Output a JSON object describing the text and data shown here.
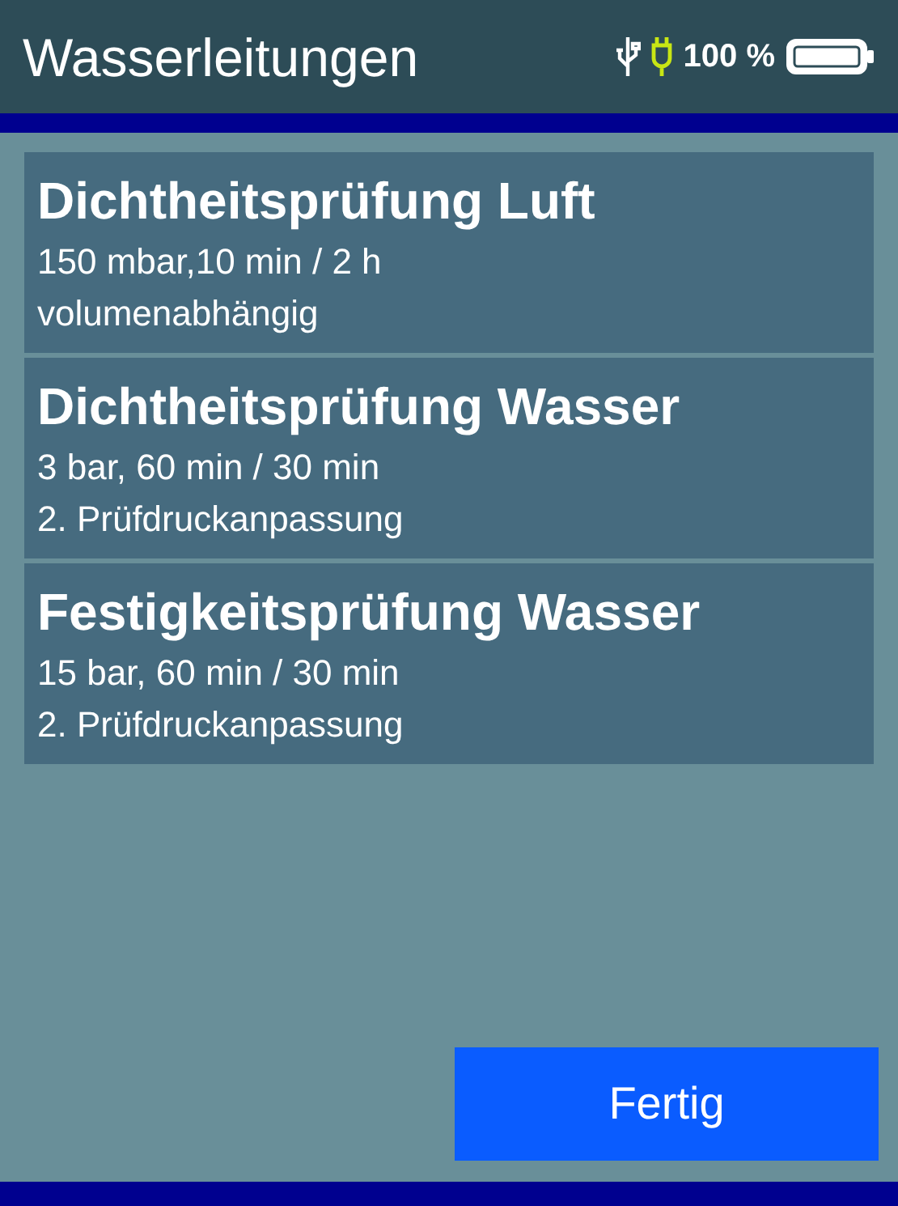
{
  "header": {
    "title": "Wasserleitungen",
    "battery_text": "100 %"
  },
  "tests": [
    {
      "title": "Dichtheitsprüfung Luft",
      "lines": [
        "150 mbar,10 min / 2 h",
        "volumenabhängig"
      ]
    },
    {
      "title": "Dichtheitsprüfung Wasser",
      "lines": [
        "3 bar, 60 min / 30 min",
        "2. Prüfdruckanpassung"
      ]
    },
    {
      "title": "Festigkeitsprüfung Wasser",
      "lines": [
        "15 bar, 60 min / 30 min",
        "2. Prüfdruckanpassung"
      ]
    }
  ],
  "button": "Fertig"
}
